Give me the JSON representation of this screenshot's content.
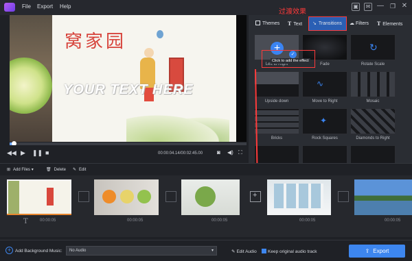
{
  "menu": {
    "file": "File",
    "export": "Export",
    "help": "Help"
  },
  "annotation_text": "过渡效果",
  "tabs": [
    {
      "label": "Themes",
      "icon": "themes-icon"
    },
    {
      "label": "Text",
      "icon": "text-icon"
    },
    {
      "label": "Transitions",
      "icon": "transitions-icon"
    },
    {
      "label": "Filters",
      "icon": "filters-icon"
    },
    {
      "label": "Elements",
      "icon": "elements-icon"
    }
  ],
  "preview": {
    "title_cn": "窝家园",
    "overlay_text": "YOUR TEXT HERE",
    "time": "00:00:04.14/00:02:45.00"
  },
  "tooltip": "Click to add the effect",
  "transitions": [
    "Left to Right",
    "Fade",
    "Rotate Scale",
    "Upside down",
    "Move to Right",
    "Mosaic",
    "Bricks",
    "Rock Squares",
    "Diamonds to Right"
  ],
  "toolbar": {
    "add_files": "Add Files",
    "delete": "Delete",
    "edit": "Edit"
  },
  "clips": [
    {
      "duration": "00:00:05"
    },
    {
      "duration": "00:00:05"
    },
    {
      "duration": "00:00:05"
    },
    {
      "duration": "00:00:05"
    },
    {
      "duration": "00:00:05"
    }
  ],
  "bottom": {
    "add_bgm": "Add Background Music:",
    "audio": "No Audio",
    "edit_audio": "Edit Audio",
    "keep_track": "Keep original audio track",
    "export": "Export"
  },
  "colors": {
    "accent": "#3d86ef",
    "annotation": "#ff3b3b",
    "progress": "#e8862e"
  }
}
